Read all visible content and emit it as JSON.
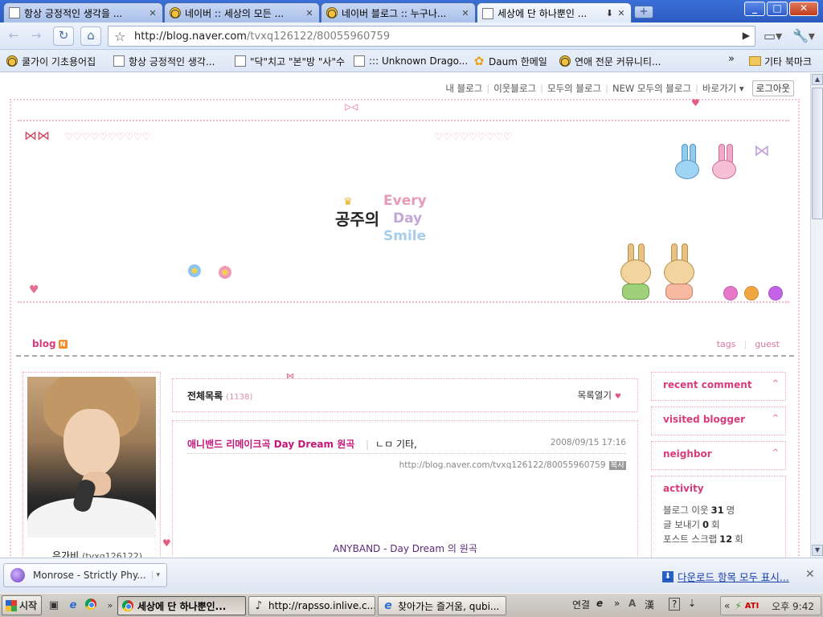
{
  "window": {
    "tabs": [
      {
        "title": "항상 긍정적인 생각을 ...",
        "icon": "doc"
      },
      {
        "title": "네이버 :: 세상의 모든 ...",
        "icon": "bee"
      },
      {
        "title": "네이버 블로그 :: 누구나...",
        "icon": "bee"
      },
      {
        "title": "세상에 단 하나뿐인 ...",
        "icon": "doc",
        "active": true
      }
    ],
    "new_tab_label": "+",
    "controls": {
      "minimize": "_",
      "maximize": "□",
      "close": "✕"
    }
  },
  "toolbar": {
    "back": "←",
    "forward": "→",
    "reload": "↻",
    "home": "⌂",
    "star": "☆",
    "url_host": "http://blog.naver.com",
    "url_path": "/tvxq126122/80055960759",
    "go": "▶",
    "page_menu": "▭▾",
    "tools_menu": "🔧▾"
  },
  "bookmarks": {
    "items": [
      {
        "label": "쿨가이 기초용어집",
        "icon": "bee"
      },
      {
        "label": "항상 긍정적인 생각...",
        "icon": "doc"
      },
      {
        "label": "\"닥\"치고 \"본\"방 \"사\"수",
        "icon": "doc"
      },
      {
        "label": "::: Unknown Drago...",
        "icon": "doc"
      },
      {
        "label": "Daum 한메일",
        "icon": "daum"
      },
      {
        "label": "연애 전문 커뮤니티...",
        "icon": "bee"
      }
    ],
    "more": "»",
    "other_folder": "기타 북마크"
  },
  "blog": {
    "topnav": [
      "내 블로그",
      "이웃블로그",
      "모두의 블로그",
      "NEW 모두의 블로그",
      "바로가기 ▾"
    ],
    "logout": "로그아웃",
    "banner": {
      "kr_title": "공주의",
      "every": "Every",
      "day": "Day",
      "smile": "Smile"
    },
    "subnav": {
      "blog": "blog",
      "new_badge": "N",
      "tags": "tags",
      "guest": "guest"
    },
    "profile": {
      "nickname": "은가비",
      "id": "(tvxq126122)"
    },
    "list_header": {
      "title": "전체목록",
      "count": "(1138)",
      "open": "목록열기"
    },
    "post": {
      "title": "애니밴드 리메이크곡 Day Dream 원곡",
      "category": "ㄴㅁ 기타,",
      "date": "2008/09/15 17:16",
      "url": "http://blog.naver.com/tvxq126122/80055960759",
      "copy": "복사",
      "body_line": "ANYBAND - Day Dream 의 원곡"
    },
    "sidebar": {
      "recent_comment": "recent comment",
      "visited_blogger": "visited blogger",
      "neighbor": "neighbor",
      "activity": "activity",
      "stats": [
        {
          "label": "블로그 이웃",
          "value": "31",
          "unit": "명"
        },
        {
          "label": "글 보내기",
          "value": "0",
          "unit": "회"
        },
        {
          "label": "포스트 스크랩",
          "value": "12",
          "unit": "회"
        }
      ]
    }
  },
  "download_shelf": {
    "item": "Monrose - Strictly Phy...",
    "show_all": "다운로드 항목 모두 표시...",
    "close": "✕"
  },
  "taskbar": {
    "start": "시작",
    "more": "»",
    "items": [
      {
        "label": "세상에 단 하나뿐인...",
        "icon": "chrome",
        "active": true
      },
      {
        "label": "http://rapsso.inlive.c...",
        "icon": "music"
      },
      {
        "label": "찾아가는 즐거움, qubi...",
        "icon": "ie"
      }
    ],
    "ime": {
      "connect": "연결",
      "a": "A",
      "hanja": "漢",
      "help": "?"
    },
    "tray_more": "«",
    "clock": "오후 9:42"
  },
  "colors": {
    "accent_pink": "#d93b7a",
    "post_title": "#c5167a",
    "chrome_blue": "#2c5cc0"
  }
}
